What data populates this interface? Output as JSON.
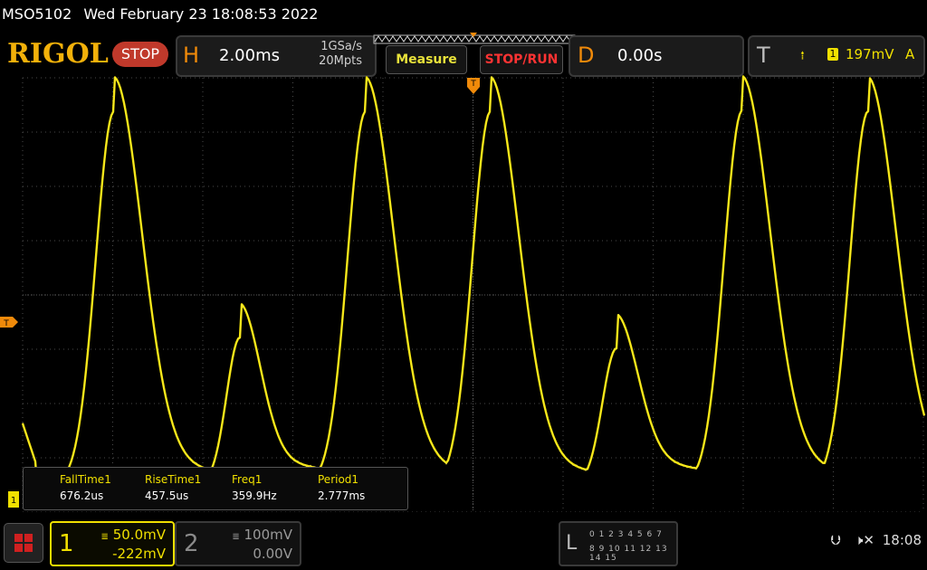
{
  "status": {
    "model": "MSO5102",
    "datetime": "Wed February 23 18:08:53 2022"
  },
  "top": {
    "logo": "RIGOL",
    "run_state": "STOP",
    "horizontal": {
      "letter": "H",
      "timebase": "2.00ms",
      "sample_rate": "1GSa/s",
      "memory_depth": "20Mpts"
    },
    "measure_label": "Measure",
    "stoprun_label": "STOP/RUN",
    "delay": {
      "letter": "D",
      "value": "0.00s"
    },
    "trigger": {
      "letter": "T",
      "slope_icon": "rising-edge-icon",
      "source": "1",
      "level": "197mV",
      "mode": "A"
    }
  },
  "screen": {
    "trigger_level_marker": "T",
    "trigger_pos_marker": "T",
    "ch1_ground_marker": "1",
    "trace_color": "#f0e000"
  },
  "measurements": [
    {
      "label": "FallTime1",
      "value": "676.2us"
    },
    {
      "label": "RiseTime1",
      "value": "457.5us"
    },
    {
      "label": "Freq1",
      "value": "359.9Hz"
    },
    {
      "label": "Period1",
      "value": "2.777ms"
    }
  ],
  "bottom": {
    "ch1": {
      "number": "1",
      "scale": "50.0mV",
      "offset": "-222mV"
    },
    "ch2": {
      "number": "2",
      "scale": "100mV",
      "offset": "0.00V"
    },
    "logic": {
      "letter": "L",
      "row1": "0 1 2 3  4 5 6 7",
      "row2": "8 9 10 11 12 13 14 15"
    },
    "clock": "18:08"
  },
  "colors": {
    "accent": "#f0e000",
    "orange": "#f08a0a",
    "stop": "#c0392b",
    "grid": "#4a4a4a"
  }
}
